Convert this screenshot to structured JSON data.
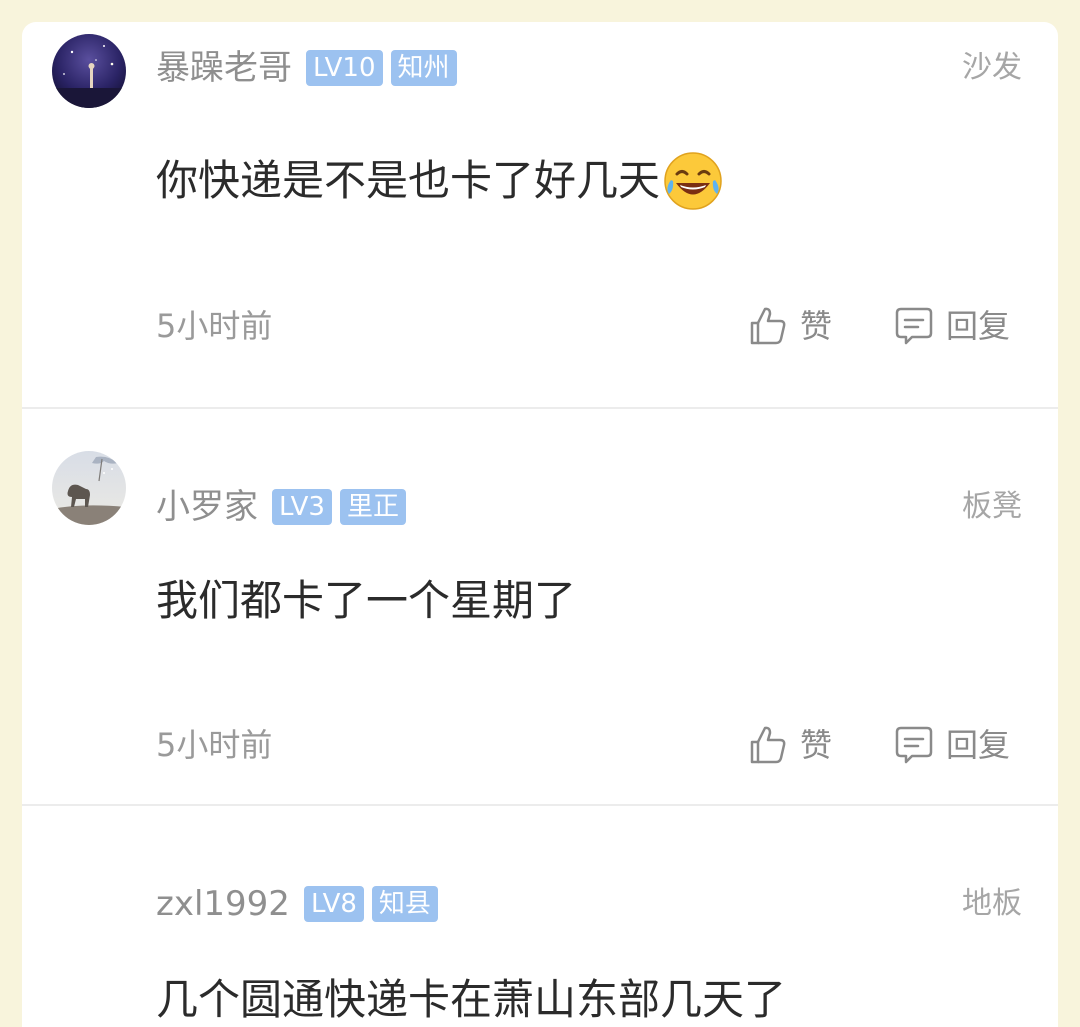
{
  "comments": [
    {
      "username": "暴躁老哥",
      "level": "LV10",
      "title": "知州",
      "floor": "沙发",
      "text": "你快递是不是也卡了好几天",
      "emoji": "laughing-crying-emoji",
      "time": "5小时前",
      "like_label": "赞",
      "reply_label": "回复"
    },
    {
      "username": "小罗家",
      "level": "LV3",
      "title": "里正",
      "floor": "板凳",
      "text": "我们都卡了一个星期了",
      "time": "5小时前",
      "like_label": "赞",
      "reply_label": "回复"
    },
    {
      "username": "zxl1992",
      "level": "LV8",
      "title": "知县",
      "floor": "地板",
      "text": "几个圆通快递卡在萧山东部几天了"
    }
  ],
  "colors": {
    "page_background": "#f8f4dc",
    "badge": "#9cc2f0",
    "username": "#8f8f8f",
    "content": "#2b2b2b"
  }
}
